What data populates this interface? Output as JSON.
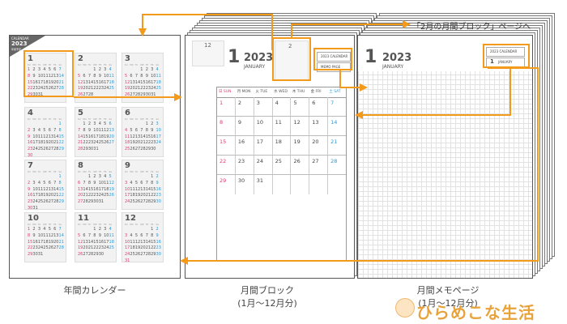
{
  "year_tag": {
    "line1": "CALENDAR",
    "line2": "2023",
    "line3": "年間予定"
  },
  "dow_en": [
    "SU",
    "MO",
    "TU",
    "WE",
    "TH",
    "FR",
    "SA"
  ],
  "year_months": [
    {
      "num": "1",
      "weeks": [
        [
          "1",
          "2",
          "3",
          "4",
          "5",
          "6",
          "7"
        ],
        [
          "8",
          "9",
          "10",
          "11",
          "12",
          "13",
          "14"
        ],
        [
          "15",
          "16",
          "17",
          "18",
          "19",
          "20",
          "21"
        ],
        [
          "22",
          "23",
          "24",
          "25",
          "26",
          "27",
          "28"
        ],
        [
          "29",
          "30",
          "31",
          "",
          "",
          "",
          ""
        ]
      ]
    },
    {
      "num": "2",
      "weeks": [
        [
          "",
          "",
          "",
          "1",
          "2",
          "3",
          "4"
        ],
        [
          "5",
          "6",
          "7",
          "8",
          "9",
          "10",
          "11"
        ],
        [
          "12",
          "13",
          "14",
          "15",
          "16",
          "17",
          "18"
        ],
        [
          "19",
          "20",
          "21",
          "22",
          "23",
          "24",
          "25"
        ],
        [
          "26",
          "27",
          "28",
          "",
          "",
          "",
          ""
        ]
      ]
    },
    {
      "num": "3",
      "weeks": [
        [
          "",
          "",
          "",
          "1",
          "2",
          "3",
          "4"
        ],
        [
          "5",
          "6",
          "7",
          "8",
          "9",
          "10",
          "11"
        ],
        [
          "12",
          "13",
          "14",
          "15",
          "16",
          "17",
          "18"
        ],
        [
          "19",
          "20",
          "21",
          "22",
          "23",
          "24",
          "25"
        ],
        [
          "26",
          "27",
          "28",
          "29",
          "30",
          "31",
          ""
        ]
      ]
    },
    {
      "num": "4",
      "weeks": [
        [
          "",
          "",
          "",
          "",
          "",
          "",
          "1"
        ],
        [
          "2",
          "3",
          "4",
          "5",
          "6",
          "7",
          "8"
        ],
        [
          "9",
          "10",
          "11",
          "12",
          "13",
          "14",
          "15"
        ],
        [
          "16",
          "17",
          "18",
          "19",
          "20",
          "21",
          "22"
        ],
        [
          "23",
          "24",
          "25",
          "26",
          "27",
          "28",
          "29"
        ],
        [
          "30",
          "",
          "",
          "",
          "",
          "",
          ""
        ]
      ]
    },
    {
      "num": "5",
      "weeks": [
        [
          "",
          "1",
          "2",
          "3",
          "4",
          "5",
          "6"
        ],
        [
          "7",
          "8",
          "9",
          "10",
          "11",
          "12",
          "13"
        ],
        [
          "14",
          "15",
          "16",
          "17",
          "18",
          "19",
          "20"
        ],
        [
          "21",
          "22",
          "23",
          "24",
          "25",
          "26",
          "27"
        ],
        [
          "28",
          "29",
          "30",
          "31",
          "",
          "",
          ""
        ]
      ]
    },
    {
      "num": "6",
      "weeks": [
        [
          "",
          "",
          "",
          "",
          "1",
          "2",
          "3"
        ],
        [
          "4",
          "5",
          "6",
          "7",
          "8",
          "9",
          "10"
        ],
        [
          "11",
          "12",
          "13",
          "14",
          "15",
          "16",
          "17"
        ],
        [
          "18",
          "19",
          "20",
          "21",
          "22",
          "23",
          "24"
        ],
        [
          "25",
          "26",
          "27",
          "28",
          "29",
          "30",
          ""
        ]
      ]
    },
    {
      "num": "7",
      "weeks": [
        [
          "",
          "",
          "",
          "",
          "",
          "",
          "1"
        ],
        [
          "2",
          "3",
          "4",
          "5",
          "6",
          "7",
          "8"
        ],
        [
          "9",
          "10",
          "11",
          "12",
          "13",
          "14",
          "15"
        ],
        [
          "16",
          "17",
          "18",
          "19",
          "20",
          "21",
          "22"
        ],
        [
          "23",
          "24",
          "25",
          "26",
          "27",
          "28",
          "29"
        ],
        [
          "30",
          "31",
          "",
          "",
          "",
          "",
          ""
        ]
      ]
    },
    {
      "num": "8",
      "weeks": [
        [
          "",
          "",
          "1",
          "2",
          "3",
          "4",
          "5"
        ],
        [
          "6",
          "7",
          "8",
          "9",
          "10",
          "11",
          "12"
        ],
        [
          "13",
          "14",
          "15",
          "16",
          "17",
          "18",
          "19"
        ],
        [
          "20",
          "21",
          "22",
          "23",
          "24",
          "25",
          "26"
        ],
        [
          "27",
          "28",
          "29",
          "30",
          "31",
          "",
          ""
        ]
      ]
    },
    {
      "num": "9",
      "weeks": [
        [
          "",
          "",
          "",
          "",
          "",
          "1",
          "2"
        ],
        [
          "3",
          "4",
          "5",
          "6",
          "7",
          "8",
          "9"
        ],
        [
          "10",
          "11",
          "12",
          "13",
          "14",
          "15",
          "16"
        ],
        [
          "17",
          "18",
          "19",
          "20",
          "21",
          "22",
          "23"
        ],
        [
          "24",
          "25",
          "26",
          "27",
          "28",
          "29",
          "30"
        ]
      ]
    },
    {
      "num": "10",
      "weeks": [
        [
          "1",
          "2",
          "3",
          "4",
          "5",
          "6",
          "7"
        ],
        [
          "8",
          "9",
          "10",
          "11",
          "12",
          "13",
          "14"
        ],
        [
          "15",
          "16",
          "17",
          "18",
          "19",
          "20",
          "21"
        ],
        [
          "22",
          "23",
          "24",
          "25",
          "26",
          "27",
          "28"
        ],
        [
          "29",
          "30",
          "31",
          "",
          "",
          "",
          ""
        ]
      ]
    },
    {
      "num": "11",
      "weeks": [
        [
          "",
          "",
          "",
          "1",
          "2",
          "3",
          "4"
        ],
        [
          "5",
          "6",
          "7",
          "8",
          "9",
          "10",
          "11"
        ],
        [
          "12",
          "13",
          "14",
          "15",
          "16",
          "17",
          "18"
        ],
        [
          "19",
          "20",
          "21",
          "22",
          "23",
          "24",
          "25"
        ],
        [
          "26",
          "27",
          "28",
          "29",
          "30",
          "",
          ""
        ]
      ]
    },
    {
      "num": "12",
      "weeks": [
        [
          "",
          "",
          "",
          "",
          "",
          "1",
          "2"
        ],
        [
          "3",
          "4",
          "5",
          "6",
          "7",
          "8",
          "9"
        ],
        [
          "10",
          "11",
          "12",
          "13",
          "14",
          "15",
          "16"
        ],
        [
          "17",
          "18",
          "19",
          "20",
          "21",
          "22",
          "23"
        ],
        [
          "24",
          "25",
          "26",
          "27",
          "28",
          "29",
          "30"
        ],
        [
          "31",
          "",
          "",
          "",
          "",
          "",
          ""
        ]
      ]
    }
  ],
  "monthly_block": {
    "month_num": "1",
    "year": "2023",
    "month_en": "JANUARY",
    "prev_label": "12",
    "next_label": "2",
    "link_btn_1": "2023 CALENDAR",
    "link_btn_2": "MEMO PAGE",
    "dow_headers": [
      "日 SUN",
      "月 MON",
      "火 TUE",
      "水 WED",
      "木 THU",
      "金 FRI",
      "土 SAT"
    ],
    "rows": [
      [
        "1",
        "2",
        "3",
        "4",
        "5",
        "6",
        "7"
      ],
      [
        "8",
        "9",
        "10",
        "11",
        "12",
        "13",
        "14"
      ],
      [
        "15",
        "16",
        "17",
        "18",
        "19",
        "20",
        "21"
      ],
      [
        "22",
        "23",
        "24",
        "25",
        "26",
        "27",
        "28"
      ],
      [
        "29",
        "30",
        "31",
        "",
        "",
        "",
        ""
      ]
    ]
  },
  "memo_page": {
    "month_num": "1",
    "year": "2023",
    "month_en": "JANUARY",
    "link_btn_1": "2023 CALENDAR",
    "link_btn_2_num": "1",
    "link_btn_2_text": "JANUARY"
  },
  "callout_label": "「2月の月間ブロック」ページへ",
  "captions": {
    "year_calendar": "年間カレンダー",
    "monthly_block_line1": "月間ブロック",
    "monthly_block_line2": "(1月〜12月分)",
    "memo_page_line1": "月間メモページ",
    "memo_page_line2": "(1月〜12月分)"
  },
  "logo_text": "ひらめこな生活",
  "colors": {
    "accent_orange": "#f39a1b",
    "sunday": "#e23a6e",
    "saturday": "#2a9bd8"
  }
}
